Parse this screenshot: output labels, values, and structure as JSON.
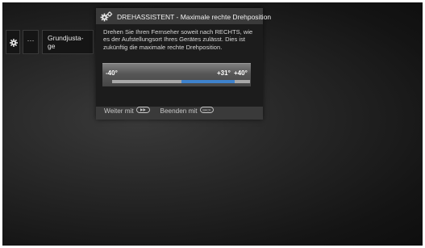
{
  "menu": {
    "items": [
      {
        "icon": "gear-icon"
      },
      {
        "label": "···"
      },
      {
        "label_line1": "Grundjusta-",
        "label_line2": "ge"
      }
    ]
  },
  "dialog": {
    "title": "DREHASSISTENT - Maximale rechte Drehposition",
    "title_icon": "gears-icon",
    "text": "Drehen Sie Ihren Fernseher soweit nach RECHTS, wie es der Aufstellungsort Ihres Gerätes zulässt. Dies ist zukünftig die maximale rechte Drehposition.",
    "range": {
      "min_label": "-40°",
      "current_label": "+31°",
      "max_label": "+40°",
      "min": -40,
      "max": 40,
      "selected_from": 0,
      "selected_to": 31
    },
    "footer": {
      "next_label": "Weiter mit",
      "next_key": "ff-key-icon",
      "end_label": "Beenden mit",
      "end_key": "back-key-icon",
      "end_key_text": "BACK"
    }
  },
  "colors": {
    "accent": "#3e82cc",
    "dialog_bg": "#3a3a3a",
    "body_bg": "#1c1c1c"
  }
}
